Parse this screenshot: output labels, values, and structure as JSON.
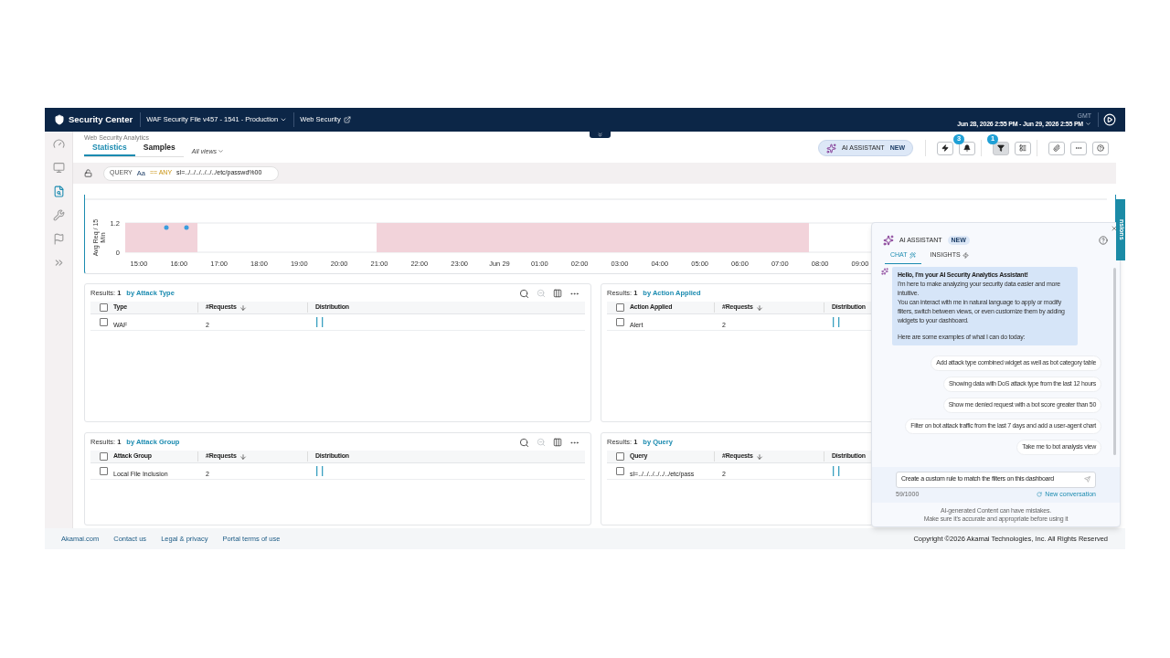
{
  "header": {
    "logo_text": "Security Center",
    "config": "WAF Security File v457 - 1541 - Production",
    "product": "Web Security",
    "timezone": "GMT",
    "date_range": "Jun 28, 2026 2:55 PM - Jun 29, 2026 2:55 PM"
  },
  "sidebar": {
    "items": [
      {
        "kind": "gauge",
        "selected": false
      },
      {
        "kind": "monitor",
        "selected": false
      },
      {
        "kind": "report",
        "selected": true
      },
      {
        "kind": "tools",
        "selected": false
      },
      {
        "kind": "flag",
        "selected": false
      },
      {
        "kind": "expand",
        "selected": false
      }
    ]
  },
  "breadcrumb": "Web Security Analytics",
  "tabs": [
    {
      "label": "Statistics",
      "selected": true
    },
    {
      "label": "Samples",
      "selected": false
    }
  ],
  "views_dropdown": "All views",
  "toolbar": {
    "ai_button": {
      "label": "AI ASSISTANT",
      "badge": "NEW"
    },
    "button_groups": [
      [
        {
          "kind": "bolt",
          "active": false
        },
        {
          "kind": "bell",
          "badge": "3",
          "active": false
        }
      ],
      [
        {
          "kind": "filter",
          "badge": "1",
          "active": true
        },
        {
          "kind": "layout",
          "active": false
        }
      ],
      [
        {
          "kind": "link",
          "active": false
        },
        {
          "kind": "more",
          "active": false
        },
        {
          "kind": "help",
          "active": false
        }
      ]
    ]
  },
  "query": {
    "label": "QUERY",
    "case": "Aa",
    "operator": "== ANY",
    "value": "sl=../../../../../../etc/passwd%00"
  },
  "chart": {
    "y_axis_label": "Avg Req / 15 Min",
    "y_tick_labels": [
      "1.2",
      "0"
    ],
    "x_tick_labels": [
      "15:00",
      "16:00",
      "17:00",
      "18:00",
      "19:00",
      "20:00",
      "21:00",
      "22:00",
      "23:00",
      "Jun 29",
      "01:00",
      "02:00",
      "03:00",
      "04:00",
      "05:00",
      "06:00",
      "07:00",
      "08:00",
      "09:00"
    ]
  },
  "panels": [
    {
      "results": "Results: **1**",
      "group_by": "by Attack Type",
      "all_checked": false,
      "columns": [
        {
          "label": "Type",
          "sorted": false
        },
        {
          "label": "#Requests",
          "sorted": true
        },
        {
          "label": "Distribution",
          "sorted": false
        }
      ],
      "rows": [
        {
          "checked": false,
          "cells": [
            "WAF",
            "2"
          ]
        }
      ]
    },
    {
      "results": "Results: **1**",
      "group_by": "by Action Applied",
      "all_checked": false,
      "columns": [
        {
          "label": "Action Applied",
          "sorted": false
        },
        {
          "label": "#Requests",
          "sorted": true
        },
        {
          "label": "Distribution",
          "sorted": false
        }
      ],
      "rows": [
        {
          "checked": false,
          "cells": [
            "Alert",
            "2"
          ]
        }
      ]
    },
    {
      "results": "Results: **1**",
      "group_by": "by Attack Group",
      "all_checked": false,
      "columns": [
        {
          "label": "Attack Group",
          "sorted": false
        },
        {
          "label": "#Requests",
          "sorted": true
        },
        {
          "label": "Distribution",
          "sorted": false
        }
      ],
      "rows": [
        {
          "checked": false,
          "cells": [
            "Local File Inclusion",
            "2"
          ]
        }
      ]
    },
    {
      "results": "Results: **1**",
      "group_by": "by Query",
      "all_checked": false,
      "columns": [
        {
          "label": "Query",
          "sorted": false
        },
        {
          "label": "#Requests",
          "sorted": true
        },
        {
          "label": "Distribution",
          "sorted": false
        }
      ],
      "rows": [
        {
          "checked": false,
          "cells": [
            "sl=../../../../../../etc/pass",
            "2"
          ]
        }
      ]
    }
  ],
  "side_tab": "nsions",
  "ai_panel": {
    "title": "AI ASSISTANT",
    "badge": "NEW",
    "tabs": [
      {
        "label": "CHAT",
        "kind": "chat",
        "selected": true
      },
      {
        "label": "INSIGHTS",
        "kind": "insights",
        "selected": false
      }
    ],
    "message": {
      "greeting": "Hello, I'm your AI Security Analytics Assistant!",
      "paragraphs": [
        "I'm here to make analyzing your security data easier and more intuitive.",
        "You can interact with me in natural language to apply or modify filters, switch between views, or even customize them by adding widgets to your dashboard.",
        "Here are some examples of what I can do today:"
      ]
    },
    "suggestions": [
      "Add attack type combined widget as well as bot category table",
      "Showing data with DoS attack type from the last 12 hours",
      "Show me denied request with a bot score greater than 50",
      "Filter on bot attack traffic from the last 7 days and add a user-agent chart",
      "Take me to bot analysis view"
    ],
    "input_value": "Create a custom rule to match the filters on this dashboard",
    "counter": "59/1000",
    "new_conversation": "New conversation",
    "disclaimer": [
      "AI-generated Content can have mistakes.",
      "Make sure it's accurate and appropriate before using it"
    ]
  },
  "footer": {
    "links": [
      "Akamai.com",
      "Contact us",
      "Legal & privacy",
      "Portal terms of use"
    ],
    "copyright": "Copyright ©2026 Akamai Technologies, Inc. All Rights Reserved"
  }
}
